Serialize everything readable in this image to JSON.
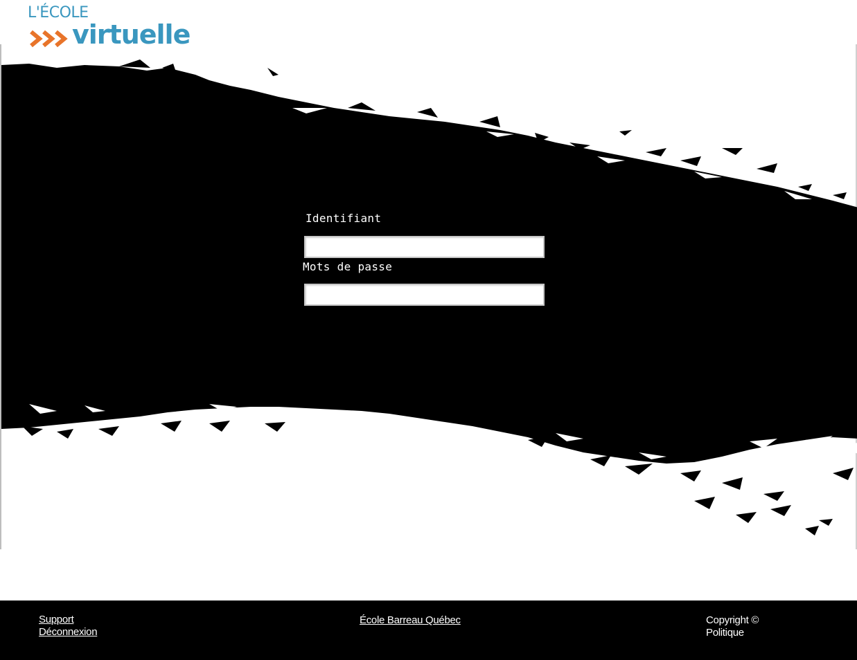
{
  "brand": {
    "logo_top": "L'ÉCOLE",
    "logo_bottom": "virtuelle",
    "logo_arrow_color": "#e8742a",
    "logo_text_color": "#3a97bf"
  },
  "login": {
    "username_label": "Identifiant",
    "username_value": "",
    "password_label": "Mots de passe",
    "password_value": ""
  },
  "footer": {
    "support_link": "Support",
    "logout_link": "Déconnexion",
    "school_link": "École Barreau Québec",
    "copyright_text": "Copyright ©",
    "policy_text": "Politique"
  },
  "colors": {
    "brush": "#000000",
    "footer_bg": "#000000",
    "page_bg": "#ffffff"
  }
}
